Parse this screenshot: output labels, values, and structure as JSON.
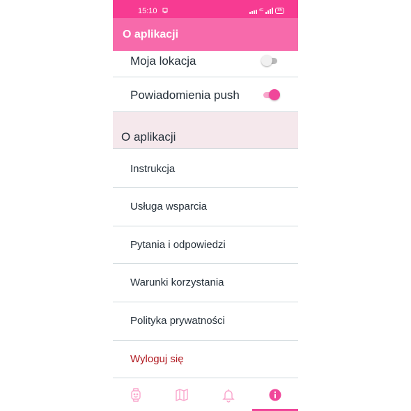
{
  "status_bar": {
    "time": "15:10",
    "battery": "85",
    "network_tag": "4G"
  },
  "app_bar": {
    "title": "O aplikacji"
  },
  "settings": {
    "my_location": {
      "label": "Moja lokacja",
      "enabled": false
    },
    "push_notifications": {
      "label": "Powiadomienia push",
      "enabled": true
    }
  },
  "section": {
    "title": "O aplikacji"
  },
  "menu": {
    "items": [
      {
        "label": "Instrukcja"
      },
      {
        "label": "Usługa wsparcia"
      },
      {
        "label": "Pytania i odpowiedzi"
      },
      {
        "label": "Warunki korzystania"
      },
      {
        "label": "Polityka prywatności"
      },
      {
        "label": "Wyloguj się",
        "color": "#b0181f"
      }
    ]
  },
  "bottom_nav": {
    "items": [
      {
        "icon": "watch-icon"
      },
      {
        "icon": "map-icon"
      },
      {
        "icon": "bell-icon"
      },
      {
        "icon": "info-icon",
        "active": true
      }
    ]
  },
  "colors": {
    "status_bar": "#f73b92",
    "app_bar": "#f76aab",
    "accent": "#f0479a",
    "section_bg": "#f5e8ec",
    "logout_text": "#b0181f"
  }
}
